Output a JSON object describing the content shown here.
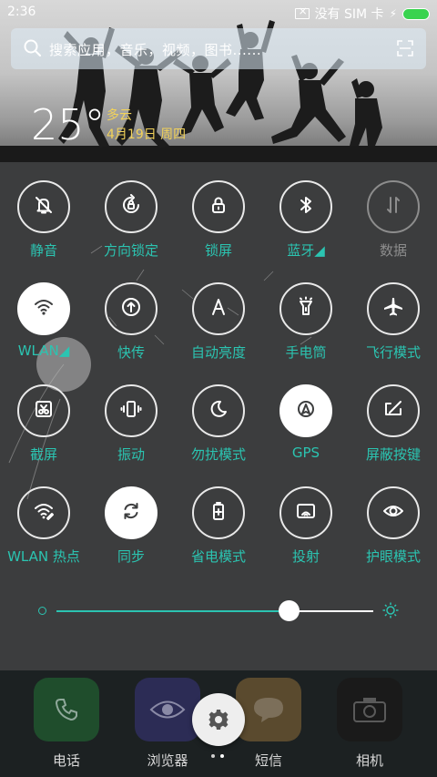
{
  "status_bar": {
    "time": "2:36",
    "carrier": "没有 SIM 卡",
    "battery_level": 1.0,
    "battery_color": "#39d34f"
  },
  "search": {
    "placeholder": "搜索应用，音乐，视频，图书......",
    "search_icon": "search-icon",
    "scan_icon": "scan-icon"
  },
  "weather": {
    "temperature": "25°",
    "condition": "多云",
    "date": "4月19日 周四"
  },
  "toggles": [
    {
      "label": "静音",
      "icon": "bell-off-icon",
      "state": "off"
    },
    {
      "label": "方向锁定",
      "icon": "rotation-lock-icon",
      "state": "off"
    },
    {
      "label": "锁屏",
      "icon": "lock-icon",
      "state": "off"
    },
    {
      "label": "蓝牙◢",
      "icon": "bluetooth-icon",
      "state": "off"
    },
    {
      "label": "数据",
      "icon": "mobile-data-icon",
      "state": "disabled"
    },
    {
      "label": "WLAN◢",
      "icon": "wifi-icon",
      "state": "on"
    },
    {
      "label": "快传",
      "icon": "quick-transfer-icon",
      "state": "off"
    },
    {
      "label": "自动亮度",
      "icon": "auto-brightness-icon",
      "state": "off"
    },
    {
      "label": "手电筒",
      "icon": "flashlight-icon",
      "state": "off"
    },
    {
      "label": "飞行模式",
      "icon": "airplane-icon",
      "state": "off"
    },
    {
      "label": "截屏",
      "icon": "screenshot-icon",
      "state": "off"
    },
    {
      "label": "振动",
      "icon": "vibrate-icon",
      "state": "off"
    },
    {
      "label": "勿扰模式",
      "icon": "moon-icon",
      "state": "off"
    },
    {
      "label": "GPS",
      "icon": "gps-icon",
      "state": "on"
    },
    {
      "label": "屏蔽按键",
      "icon": "block-keys-icon",
      "state": "off"
    },
    {
      "label": "WLAN 热点",
      "icon": "hotspot-icon",
      "state": "off"
    },
    {
      "label": "同步",
      "icon": "sync-icon",
      "state": "on"
    },
    {
      "label": "省电模式",
      "icon": "battery-saver-icon",
      "state": "off"
    },
    {
      "label": "投射",
      "icon": "cast-icon",
      "state": "off"
    },
    {
      "label": "护眼模式",
      "icon": "eye-icon",
      "state": "off"
    }
  ],
  "brightness": {
    "value": 0.735
  },
  "dock": {
    "apps": [
      {
        "label": "电话",
        "icon": "phone-icon",
        "color": "#1f4d2c"
      },
      {
        "label": "浏览器",
        "icon": "browser-icon",
        "color": "#2c2c55"
      },
      {
        "label": "短信",
        "icon": "message-icon",
        "color": "#5a4a2e"
      },
      {
        "label": "相机",
        "icon": "camera-icon",
        "color": "#1a1a1a"
      }
    ],
    "settings_icon": "gear-icon",
    "page_count": 2,
    "active_page": 1
  },
  "colors": {
    "accent": "#2bc4b1",
    "disabled": "#8d8d8d"
  }
}
